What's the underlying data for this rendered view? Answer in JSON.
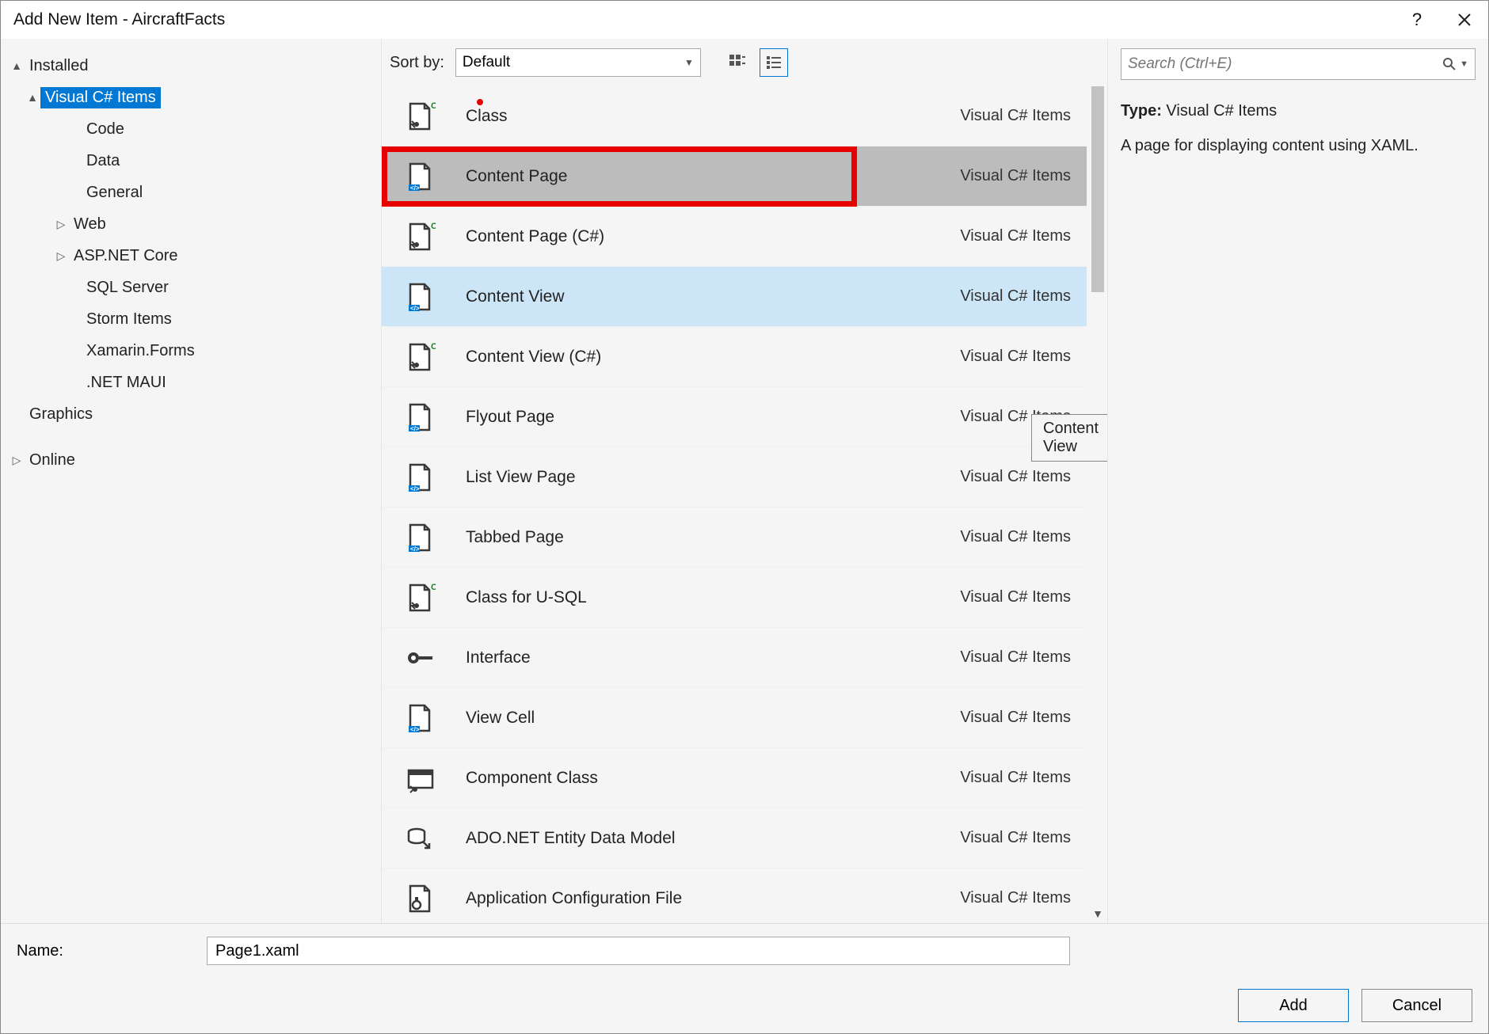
{
  "title": "Add New Item - AircraftFacts",
  "tree": {
    "root": "Installed",
    "selected": "Visual C# Items",
    "children": [
      "Code",
      "Data",
      "General",
      "Web",
      "ASP.NET Core",
      "SQL Server",
      "Storm Items",
      "Xamarin.Forms",
      ".NET MAUI"
    ],
    "graphics": "Graphics",
    "online": "Online"
  },
  "toolbar": {
    "sort_label": "Sort by:",
    "sort_value": "Default"
  },
  "items": [
    {
      "name": "Class",
      "cat": "Visual C# Items",
      "icon": "class"
    },
    {
      "name": "Content Page",
      "cat": "Visual C# Items",
      "icon": "xaml",
      "selected": true,
      "highlight": true
    },
    {
      "name": "Content Page (C#)",
      "cat": "Visual C# Items",
      "icon": "class"
    },
    {
      "name": "Content View",
      "cat": "Visual C# Items",
      "icon": "xaml",
      "hover": true
    },
    {
      "name": "Content View (C#)",
      "cat": "Visual C# Items",
      "icon": "class"
    },
    {
      "name": "Flyout Page",
      "cat": "Visual C# Items",
      "icon": "xaml"
    },
    {
      "name": "List View Page",
      "cat": "Visual C# Items",
      "icon": "xaml"
    },
    {
      "name": "Tabbed Page",
      "cat": "Visual C# Items",
      "icon": "xaml"
    },
    {
      "name": "Class for U-SQL",
      "cat": "Visual C# Items",
      "icon": "class"
    },
    {
      "name": "Interface",
      "cat": "Visual C# Items",
      "icon": "interface"
    },
    {
      "name": "View Cell",
      "cat": "Visual C# Items",
      "icon": "xaml"
    },
    {
      "name": "Component Class",
      "cat": "Visual C# Items",
      "icon": "component"
    },
    {
      "name": "ADO.NET Entity Data Model",
      "cat": "Visual C# Items",
      "icon": "entity"
    },
    {
      "name": "Application Configuration File",
      "cat": "Visual C# Items",
      "icon": "config"
    }
  ],
  "tooltip": "Content View",
  "search": {
    "placeholder": "Search (Ctrl+E)"
  },
  "details": {
    "type_label": "Type:",
    "type_value": "Visual C# Items",
    "description": "A page for displaying content using XAML."
  },
  "bottom": {
    "name_label": "Name:",
    "name_value": "Page1.xaml",
    "add": "Add",
    "cancel": "Cancel"
  }
}
